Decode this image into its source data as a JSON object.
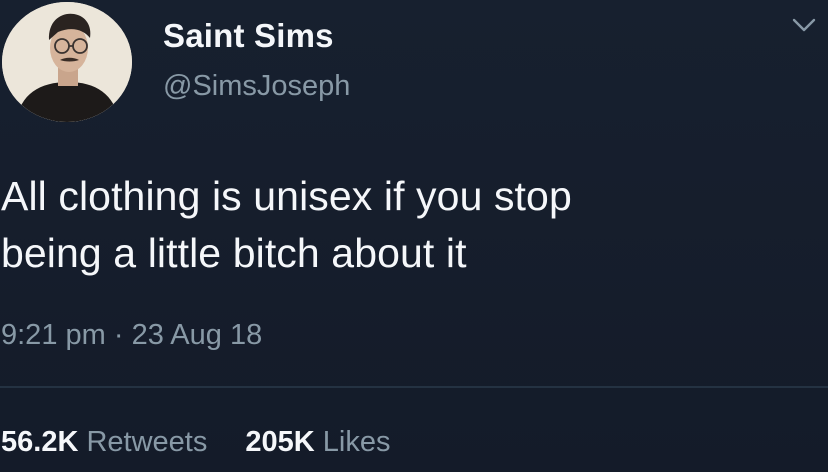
{
  "author": {
    "display_name": "Saint Sims",
    "handle": "@SimsJoseph",
    "avatar_icon": "profile-photo"
  },
  "tweet": {
    "text": "All clothing is unisex if you stop\nbeing a little bitch about it",
    "time": "9:21 pm",
    "separator": "·",
    "date": "23 Aug 18"
  },
  "stats": {
    "retweets_count": "56.2K",
    "retweets_label": "Retweets",
    "likes_count": "205K",
    "likes_label": "Likes"
  },
  "colors": {
    "background": "#151c2b",
    "primary_text": "#f5f7fa",
    "secondary_text": "#8899a6",
    "divider": "#243242"
  },
  "icons": {
    "menu": "chevron-down-icon"
  }
}
